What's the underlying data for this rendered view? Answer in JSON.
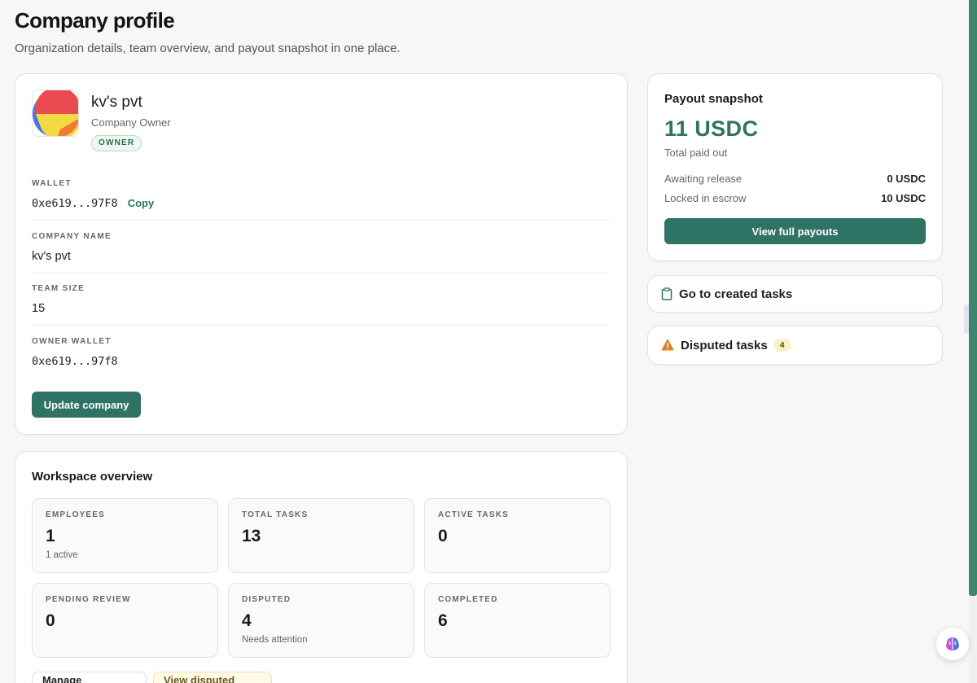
{
  "header": {
    "title": "Company profile",
    "subtitle": "Organization details, team overview, and payout snapshot in one place."
  },
  "profile": {
    "name": "kv's pvt",
    "role": "Company Owner",
    "badge": "OWNER",
    "fields": [
      {
        "label": "WALLET",
        "value": "0xe619...97F8"
      },
      {
        "label": "COMPANY NAME",
        "value": "kv's pvt"
      },
      {
        "label": "TEAM SIZE",
        "value": "15"
      },
      {
        "label": "OWNER WALLET",
        "value": "0xe619...97f8"
      }
    ],
    "copy_label": "Copy",
    "update_label": "Update company"
  },
  "overview": {
    "title": "Workspace overview",
    "stats": [
      {
        "label": "EMPLOYEES",
        "value": "1",
        "sub": "1 active"
      },
      {
        "label": "TOTAL TASKS",
        "value": "13",
        "sub": ""
      },
      {
        "label": "ACTIVE TASKS",
        "value": "0",
        "sub": ""
      },
      {
        "label": "PENDING REVIEW",
        "value": "0",
        "sub": ""
      },
      {
        "label": "DISPUTED",
        "value": "4",
        "sub": "Needs attention"
      },
      {
        "label": "COMPLETED",
        "value": "6",
        "sub": ""
      }
    ],
    "manage_label": "Manage employees",
    "view_disputed_label": "View disputed tasks"
  },
  "payout": {
    "title": "Payout snapshot",
    "amount": "11 USDC",
    "amount_sub": "Total paid out",
    "rows": [
      {
        "label": "Awaiting release",
        "value": "0 USDC"
      },
      {
        "label": "Locked in escrow",
        "value": "10 USDC"
      }
    ],
    "button_label": "View full payouts"
  },
  "links": {
    "created": {
      "label": "Go to created tasks",
      "icon": "clipboard-icon"
    },
    "disputed": {
      "label": "Disputed tasks",
      "count": "4",
      "icon": "warning-icon"
    }
  },
  "colors": {
    "accent": "#2f7365",
    "warning": "#d9822b",
    "badge_green": "#eef8f1",
    "badge_yellow": "#fbf0c9"
  }
}
